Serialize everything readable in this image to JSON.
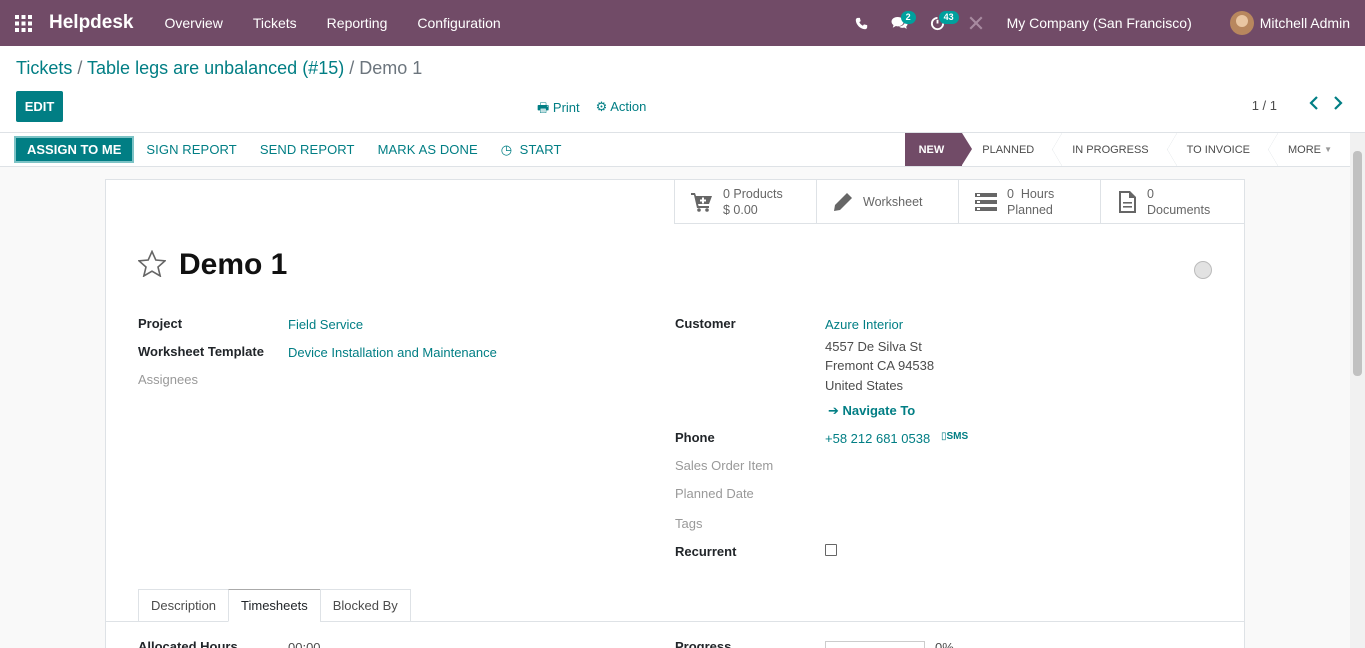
{
  "navbar": {
    "brand": "Helpdesk",
    "menu": [
      "Overview",
      "Tickets",
      "Reporting",
      "Configuration"
    ],
    "messages_count": "2",
    "activities_count": "43",
    "company": "My Company (San Francisco)",
    "user": "Mitchell Admin"
  },
  "breadcrumb": {
    "tickets": "Tickets",
    "sep1": " / ",
    "ticket": "Table legs are unbalanced (#15)",
    "sep2": " / ",
    "current": "Demo 1"
  },
  "control": {
    "edit_label": "EDIT",
    "print_label": "Print",
    "action_label": "Action",
    "pager": "1 / 1"
  },
  "statusbar": {
    "assign_label": "ASSIGN TO ME",
    "sign_label": "SIGN REPORT",
    "send_label": "SEND REPORT",
    "done_label": "MARK AS DONE",
    "start_label": "START",
    "stages": [
      "NEW",
      "PLANNED",
      "IN PROGRESS",
      "TO INVOICE",
      "MORE"
    ]
  },
  "smart_buttons": {
    "products_count": "0 Products",
    "products_amount": "$ 0.00",
    "worksheet": "Worksheet",
    "hours_value": "0  Hours",
    "hours_label": "Planned",
    "docs_count": "0",
    "docs_label": "Documents"
  },
  "record": {
    "title": "Demo 1",
    "project_label": "Project",
    "project": "Field Service",
    "template_label": "Worksheet Template",
    "template": "Device Installation and Maintenance",
    "assignees_label": "Assignees",
    "customer_label": "Customer",
    "customer": "Azure Interior",
    "address1": "4557 De Silva St",
    "address2": "Fremont CA 94538",
    "address3": "United States",
    "navigate": "Navigate To",
    "phone_label": "Phone",
    "phone": "+58 212 681 0538",
    "sms": "SMS",
    "so_item_label": "Sales Order Item",
    "planned_date_label": "Planned Date",
    "tags_label": "Tags",
    "recurrent_label": "Recurrent",
    "recurrent_checked": false
  },
  "tabs": [
    "Description",
    "Timesheets",
    "Blocked By"
  ],
  "timesheets": {
    "allocated_label": "Allocated Hours",
    "allocated_value": "00:00",
    "progress_label": "Progress",
    "progress_value": "0%"
  },
  "colors": {
    "brand": "#714b67",
    "accent": "#017e84"
  }
}
